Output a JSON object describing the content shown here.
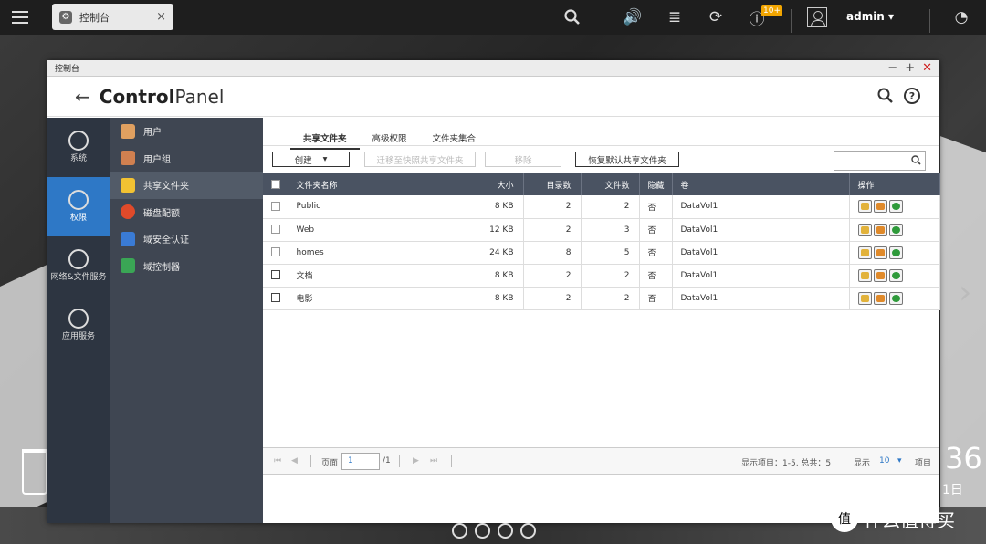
{
  "taskbar": {
    "app_tab_label": "控制台",
    "notification_badge": "10+",
    "user": "admin"
  },
  "window": {
    "title": "控制台",
    "cp_title_part1": "Control",
    "cp_title_part2": "Panel"
  },
  "left_nav": [
    {
      "label": "系统",
      "icon": "gear-icon"
    },
    {
      "label": "权限",
      "icon": "user-icon",
      "active": true
    },
    {
      "label": "网络&文件服务",
      "icon": "globe-icon"
    },
    {
      "label": "应用服务",
      "icon": "apps-icon"
    }
  ],
  "sub_nav": [
    {
      "label": "用户",
      "color": "#e0a060"
    },
    {
      "label": "用户组",
      "color": "#d08050"
    },
    {
      "label": "共享文件夹",
      "color": "#f2c232",
      "active": true
    },
    {
      "label": "磁盘配额",
      "color": "#e04a2a"
    },
    {
      "label": "域安全认证",
      "color": "#3a7bd5"
    },
    {
      "label": "域控制器",
      "color": "#3aa655"
    }
  ],
  "tabs": [
    {
      "label": "共享文件夹",
      "active": true
    },
    {
      "label": "高级权限"
    },
    {
      "label": "文件夹集合"
    }
  ],
  "toolbar": {
    "create": "创建",
    "migrate": "迁移至快照共享文件夹",
    "remove": "移除",
    "restore": "恢复默认共享文件夹"
  },
  "table": {
    "headers": [
      "文件夹名称",
      "大小",
      "目录数",
      "文件数",
      "隐藏",
      "卷",
      "操作"
    ],
    "rows": [
      {
        "name": "Public",
        "size": "8 KB",
        "dirs": "2",
        "files": "2",
        "hidden": "否",
        "volume": "DataVol1"
      },
      {
        "name": "Web",
        "size": "12 KB",
        "dirs": "2",
        "files": "3",
        "hidden": "否",
        "volume": "DataVol1"
      },
      {
        "name": "homes",
        "size": "24 KB",
        "dirs": "8",
        "files": "5",
        "hidden": "否",
        "volume": "DataVol1"
      },
      {
        "name": "文档",
        "size": "8 KB",
        "dirs": "2",
        "files": "2",
        "hidden": "否",
        "volume": "DataVol1"
      },
      {
        "name": "电影",
        "size": "8 KB",
        "dirs": "2",
        "files": "2",
        "hidden": "否",
        "volume": "DataVol1"
      }
    ]
  },
  "pager": {
    "page_label": "页面",
    "page_value": "1",
    "page_total": "/1",
    "display_items": "显示项目：1-5, 总共：5",
    "display_label": "显示",
    "per_page": "10",
    "items_label": "项目"
  },
  "desktop": {
    "clock": "36",
    "date": "1日",
    "watermark": "什么值得买",
    "watermark_logo": "值"
  }
}
